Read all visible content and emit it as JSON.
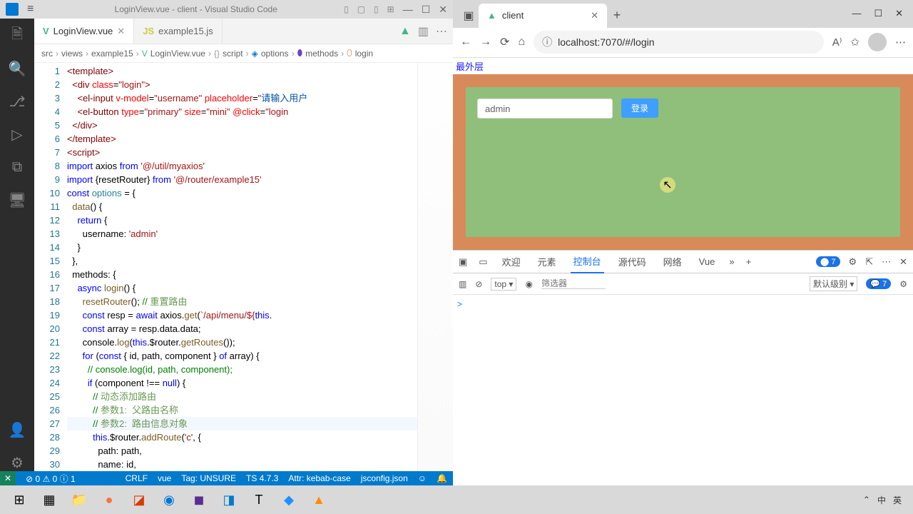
{
  "vscode": {
    "title": "LoginView.vue - client - Visual Studio Code",
    "tabs": [
      {
        "icon": "V",
        "label": "LoginView.vue",
        "active": true
      },
      {
        "icon": "JS",
        "label": "example15.js",
        "active": false
      }
    ],
    "breadcrumb": [
      "src",
      "views",
      "example15",
      "LoginView.vue",
      "script",
      "options",
      "methods",
      "login"
    ],
    "code": {
      "lines": [
        {
          "n": 1,
          "html": "<span class='tag'>&lt;template&gt;</span>"
        },
        {
          "n": 2,
          "html": "  <span class='tag'>&lt;div</span> <span class='attr'>class</span>=<span class='str'>\"login\"</span><span class='tag'>&gt;</span>"
        },
        {
          "n": 3,
          "html": "    <span class='tag'>&lt;el-input</span> <span class='attr'>v-model</span>=<span class='str'>\"username\"</span> <span class='attr'>placeholder</span>=<span class='str'>\"</span><span class='ch'>请输入用户</span>"
        },
        {
          "n": 4,
          "html": "    <span class='tag'>&lt;el-button</span> <span class='attr'>type</span>=<span class='str'>\"primary\"</span> <span class='attr'>size</span>=<span class='str'>\"mini\"</span> <span class='attr'>@click</span>=<span class='str'>\"login</span>"
        },
        {
          "n": 5,
          "html": "  <span class='tag'>&lt;/div&gt;</span>"
        },
        {
          "n": 6,
          "html": "<span class='tag'>&lt;/template&gt;</span>"
        },
        {
          "n": 7,
          "html": "<span class='tag'>&lt;script&gt;</span>"
        },
        {
          "n": 8,
          "html": "<span class='kw'>import</span> axios <span class='kw'>from</span> <span class='str'>'@/util/myaxios'</span>"
        },
        {
          "n": 9,
          "html": "<span class='kw'>import</span> {resetRouter} <span class='kw'>from</span> <span class='str'>'@/router/example15'</span>"
        },
        {
          "n": 10,
          "html": "<span class='kw'>const</span> <span class='cn'>options</span> = {"
        },
        {
          "n": 11,
          "html": "  <span class='fn'>data</span>() {"
        },
        {
          "n": 12,
          "html": "    <span class='kw'>return</span> {"
        },
        {
          "n": 13,
          "html": "      username: <span class='str'>'admin'</span>"
        },
        {
          "n": 14,
          "html": "    }"
        },
        {
          "n": 15,
          "html": "  },"
        },
        {
          "n": 16,
          "html": "  methods: {"
        },
        {
          "n": 17,
          "html": "    <span class='kw'>async</span> <span class='fn'>login</span>() {"
        },
        {
          "n": 18,
          "html": "      <span class='fn'>resetRouter</span>(); <span class='cmt'>// </span><span class='zh'>重置路由</span>"
        },
        {
          "n": 19,
          "html": "      <span class='kw'>const</span> resp = <span class='kw'>await</span> axios.<span class='fn'>get</span>(<span class='str'>`/api/menu/${</span><span class='kw'>this</span>."
        },
        {
          "n": 20,
          "html": "      <span class='kw'>const</span> array = resp.data.data;"
        },
        {
          "n": 21,
          "html": "      console.<span class='fn'>log</span>(<span class='kw'>this</span>.$router.<span class='fn'>getRoutes</span>());"
        },
        {
          "n": 22,
          "html": "      <span class='kw'>for</span> (<span class='kw'>const</span> { id, path, component } <span class='kw'>of</span> array) {"
        },
        {
          "n": 23,
          "html": "        <span class='cmt'>// console.log(id, path, component);</span>"
        },
        {
          "n": 24,
          "html": "        <span class='kw'>if</span> (component !== <span class='kw'>null</span>) {"
        },
        {
          "n": 25,
          "html": "          <span class='cmt'>// </span><span class='zh'>动态添加路由</span>"
        },
        {
          "n": 26,
          "html": "          <span class='cmt'>// </span><span class='zh'>参数1:  父路由名称</span>"
        },
        {
          "n": 27,
          "html": "          <span class='cmt'>// </span><span class='zh'>参数2:  路由信息对象</span>",
          "hl": true
        },
        {
          "n": 28,
          "html": "          <span class='kw'>this</span>.$router.<span class='fn'>addRoute</span>(<span class='str'>'c'</span>, {"
        },
        {
          "n": 29,
          "html": "            path: path,"
        },
        {
          "n": 30,
          "html": "            name: id,"
        }
      ]
    },
    "status": {
      "errors": "0",
      "warnings": "0",
      "hints": "1",
      "crlf": "CRLF",
      "lang": "vue",
      "tag": "Tag: UNSURE",
      "ts": "TS 4.7.3",
      "attr": "Attr: kebab-case",
      "jsconf": "jsconfig.json"
    }
  },
  "browser": {
    "tab_title": "client",
    "url": "localhost:7070/#/login",
    "page": {
      "outer_label": "最外层",
      "input_value": "admin",
      "login_btn": "登录"
    },
    "devtools": {
      "tabs": [
        "欢迎",
        "元素",
        "控制台",
        "源代码",
        "网络",
        "Vue"
      ],
      "active_tab": "控制台",
      "issue_count": "7",
      "context": "top",
      "filter_placeholder": "筛选器",
      "level": "默认级别",
      "msg_count": "7",
      "prompt": ">"
    }
  },
  "taskbar": {
    "ime": "中",
    "lang": "英"
  }
}
